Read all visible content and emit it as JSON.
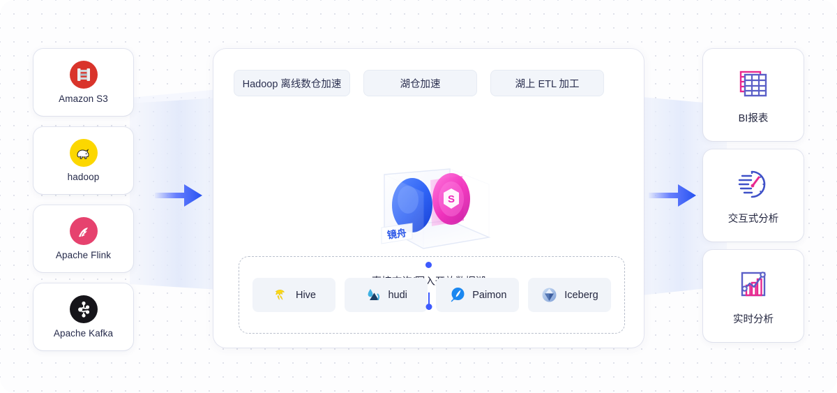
{
  "theme": {
    "accent_blue": "#3d5afe",
    "accent_pink": "#e8288f",
    "panel_bg": "#ffffff",
    "page_bg": "#fdfdfe",
    "pill_bg": "#f2f5fa",
    "dashed_border": "#b9bfcc"
  },
  "sources": {
    "items": [
      {
        "label": "Amazon S3",
        "icon": "amazon-s3-icon"
      },
      {
        "label": "hadoop",
        "icon": "hadoop-icon"
      },
      {
        "label": "Apache Flink",
        "icon": "apache-flink-icon"
      },
      {
        "label": "Apache Kafka",
        "icon": "apache-kafka-icon"
      }
    ]
  },
  "arrows": {
    "left": "flow-arrow-right-icon",
    "right": "flow-arrow-right-icon"
  },
  "center": {
    "scenarios": [
      {
        "label": "Hadoop 离线数仓加速"
      },
      {
        "label": "湖仓加速"
      },
      {
        "label": "湖上 ETL 加工"
      }
    ],
    "illustration": {
      "brand_label": "镜舟",
      "logo_glyph": "S",
      "name": "mirrorship-3d-illustration"
    },
    "connector": {
      "caption": "直接查询/写入开放数据湖"
    },
    "lake_formats": [
      {
        "label": "Hive",
        "icon": "apache-hive-icon"
      },
      {
        "label": "hudi",
        "icon": "apache-hudi-icon"
      },
      {
        "label": "Paimon",
        "icon": "apache-paimon-icon"
      },
      {
        "label": "Iceberg",
        "icon": "apache-iceberg-icon"
      }
    ]
  },
  "outcomes": {
    "items": [
      {
        "label": "BI报表",
        "icon": "bi-report-table-icon"
      },
      {
        "label": "交互式分析",
        "icon": "interactive-analysis-gauge-icon"
      },
      {
        "label": "实时分析",
        "icon": "realtime-analysis-chart-icon"
      }
    ]
  }
}
